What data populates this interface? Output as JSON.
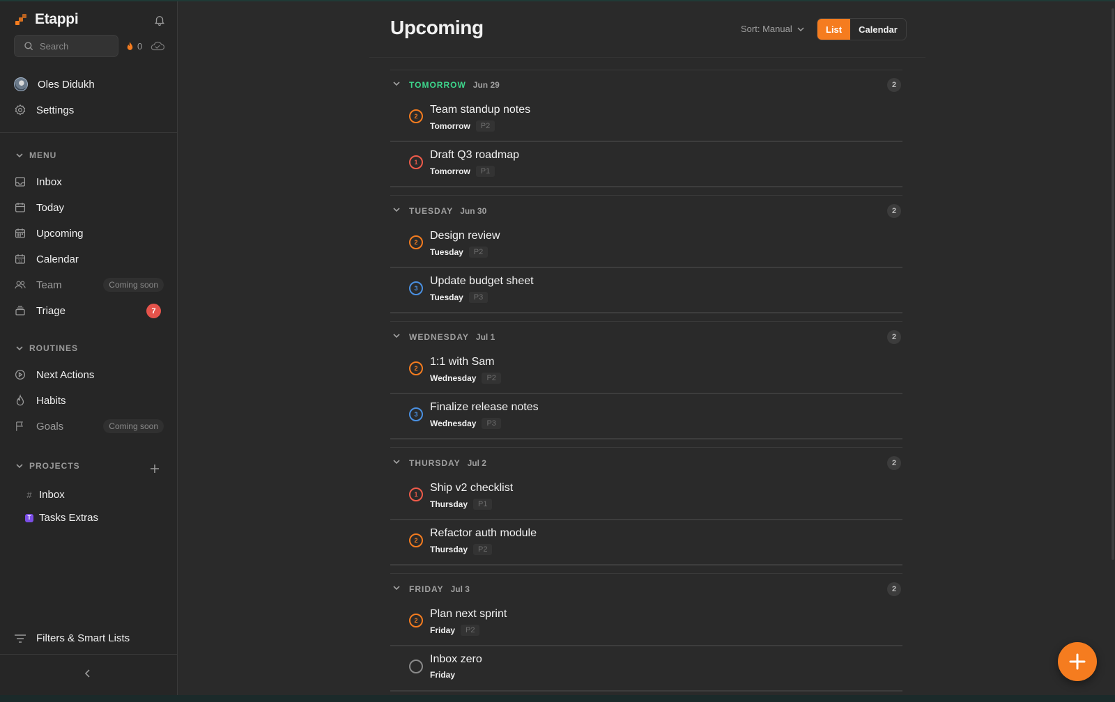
{
  "app": {
    "name": "Etappi",
    "accent": "#f57c1f"
  },
  "sidebar": {
    "search_placeholder": "Search",
    "streak_count": "0",
    "user_name": "Oles Didukh",
    "settings_label": "Settings",
    "menu_heading": "MENU",
    "menu_items": [
      {
        "label": "Inbox",
        "icon": "inbox-icon"
      },
      {
        "label": "Today",
        "icon": "calendar-today-icon"
      },
      {
        "label": "Upcoming",
        "icon": "calendar-upcoming-icon"
      },
      {
        "label": "Calendar",
        "icon": "calendar-12-icon"
      },
      {
        "label": "Team",
        "icon": "team-icon",
        "badge": "Coming soon"
      },
      {
        "label": "Triage",
        "icon": "triage-icon",
        "count": "7"
      }
    ],
    "routines_heading": "ROUTINES",
    "routine_items": [
      {
        "label": "Next Actions",
        "icon": "play-circle-icon"
      },
      {
        "label": "Habits",
        "icon": "flame-icon"
      },
      {
        "label": "Goals",
        "icon": "flag-icon",
        "badge": "Coming soon"
      }
    ],
    "projects_heading": "PROJECTS",
    "project_items": [
      {
        "label": "Inbox",
        "icon": "hash-icon"
      },
      {
        "label": "Tasks Extras",
        "icon": "project-badge",
        "badge_letter": "T",
        "color": "#7b4ee6"
      }
    ],
    "filters_label": "Filters & Smart Lists"
  },
  "header": {
    "title": "Upcoming",
    "sort_label": "Sort: Manual",
    "view_list": "List",
    "view_calendar": "Calendar"
  },
  "days": [
    {
      "name": "TOMORROW",
      "date": "Jun 29",
      "count": "2",
      "tasks": [
        {
          "title": "Team standup notes",
          "day": "Tomorrow",
          "priority": "P2",
          "prio_num": "2"
        },
        {
          "title": "Draft Q3 roadmap",
          "day": "Tomorrow",
          "priority": "P1",
          "prio_num": "1"
        }
      ]
    },
    {
      "name": "TUESDAY",
      "date": "Jun 30",
      "count": "2",
      "tasks": [
        {
          "title": "Design review",
          "day": "Tuesday",
          "priority": "P2",
          "prio_num": "2"
        },
        {
          "title": "Update budget sheet",
          "day": "Tuesday",
          "priority": "P3",
          "prio_num": "3"
        }
      ]
    },
    {
      "name": "WEDNESDAY",
      "date": "Jul 1",
      "count": "2",
      "tasks": [
        {
          "title": "1:1 with Sam",
          "day": "Wednesday",
          "priority": "P2",
          "prio_num": "2"
        },
        {
          "title": "Finalize release notes",
          "day": "Wednesday",
          "priority": "P3",
          "prio_num": "3"
        }
      ]
    },
    {
      "name": "THURSDAY",
      "date": "Jul 2",
      "count": "2",
      "tasks": [
        {
          "title": "Ship v2 checklist",
          "day": "Thursday",
          "priority": "P1",
          "prio_num": "1"
        },
        {
          "title": "Refactor auth module",
          "day": "Thursday",
          "priority": "P2",
          "prio_num": "2"
        }
      ]
    },
    {
      "name": "FRIDAY",
      "date": "Jul 3",
      "count": "2",
      "tasks": [
        {
          "title": "Plan next sprint",
          "day": "Friday",
          "priority": "P2",
          "prio_num": "2"
        },
        {
          "title": "Inbox zero",
          "day": "Friday",
          "priority": "",
          "prio_num": ""
        }
      ]
    }
  ]
}
